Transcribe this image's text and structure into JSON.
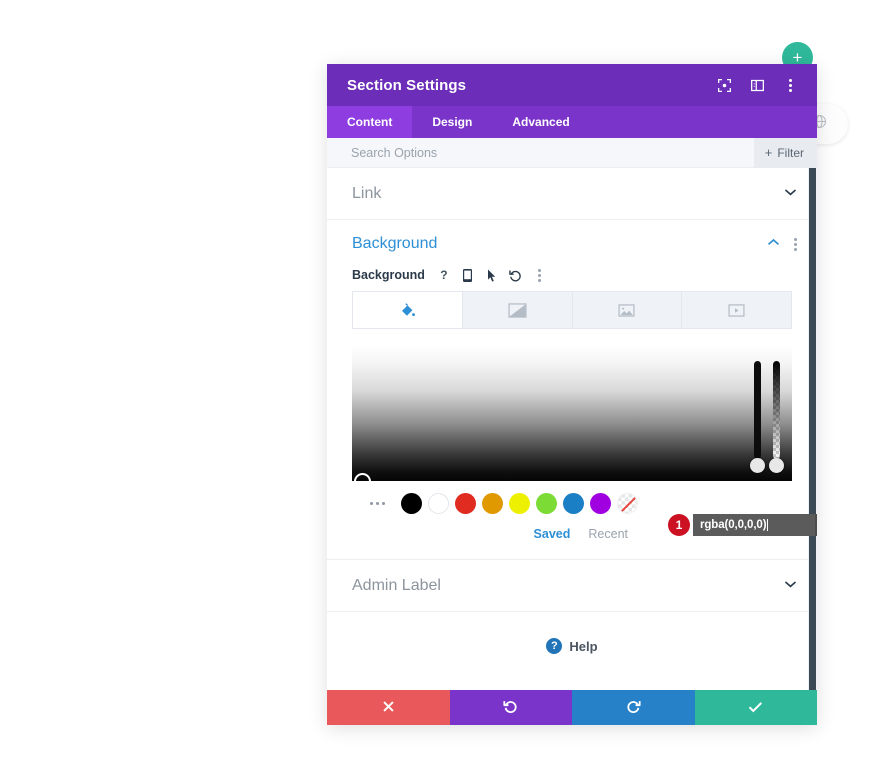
{
  "canvas": {
    "background": "#ffffff",
    "add_section_button": {
      "label": "+",
      "color": "#2fb99a",
      "icon": "plus-icon"
    },
    "globe_button": {
      "icon": "globe-icon"
    }
  },
  "panel": {
    "title": "Section Settings",
    "accent": "#6c2eb9",
    "header_icons": [
      {
        "name": "fullscreen-icon"
      },
      {
        "name": "split-view-icon"
      },
      {
        "name": "more-options-icon"
      }
    ],
    "tabs": [
      {
        "label": "Content",
        "active": true
      },
      {
        "label": "Design",
        "active": false
      },
      {
        "label": "Advanced",
        "active": false
      }
    ],
    "search": {
      "placeholder": "Search Options",
      "value": "",
      "filter_label": "Filter",
      "filter_plus": "+"
    },
    "sections": [
      {
        "label": "Link",
        "state": "collapsed"
      },
      {
        "label": "Background",
        "state": "expanded"
      },
      {
        "label": "Admin Label",
        "state": "collapsed"
      }
    ],
    "background_section": {
      "title": "Background",
      "field_label": "Background",
      "field_icons": [
        {
          "name": "help-icon",
          "glyph": "?"
        },
        {
          "name": "responsive-mobile-icon"
        },
        {
          "name": "hover-cursor-icon"
        },
        {
          "name": "reset-icon"
        },
        {
          "name": "option-menu-icon"
        }
      ],
      "type_tabs": [
        {
          "name": "background-color-tab",
          "icon": "paint-bucket-icon",
          "active": true
        },
        {
          "name": "background-gradient-tab",
          "icon": "gradient-icon",
          "active": false
        },
        {
          "name": "background-image-tab",
          "icon": "image-icon",
          "active": false
        },
        {
          "name": "background-video-tab",
          "icon": "video-icon",
          "active": false
        }
      ],
      "color_picker": {
        "input_value": "rgba(0,0,0,0)",
        "confirm_icon": "checkmark-icon",
        "step_badge": "1",
        "badge_color": "#cc1122",
        "hue_slider": {
          "name": "hue-slider",
          "value": 0
        },
        "alpha_slider": {
          "name": "alpha-slider",
          "value": 0
        }
      },
      "swatches": [
        {
          "name": "swatch-more",
          "color": ""
        },
        {
          "name": "swatch-black",
          "color": "#000000"
        },
        {
          "name": "swatch-white",
          "color": "#ffffff"
        },
        {
          "name": "swatch-red",
          "color": "#e02b20"
        },
        {
          "name": "swatch-orange",
          "color": "#e09900"
        },
        {
          "name": "swatch-yellow",
          "color": "#edf000"
        },
        {
          "name": "swatch-green",
          "color": "#7cdb34"
        },
        {
          "name": "swatch-blue",
          "color": "#1a7fc4"
        },
        {
          "name": "swatch-purple",
          "color": "#a000e0"
        },
        {
          "name": "swatch-transparent",
          "color": "none"
        }
      ],
      "palette_tabs": [
        {
          "label": "Saved",
          "active": true
        },
        {
          "label": "Recent",
          "active": false
        }
      ]
    },
    "help": {
      "label": "Help",
      "icon": "question-circle-icon"
    },
    "footer_buttons": [
      {
        "name": "cancel-button",
        "icon": "close-icon",
        "glyph": "✖",
        "color": "#e9595b"
      },
      {
        "name": "undo-button",
        "icon": "undo-icon",
        "glyph": "↺",
        "color": "#7b34c9"
      },
      {
        "name": "redo-button",
        "icon": "redo-icon",
        "glyph": "↻",
        "color": "#2681c8"
      },
      {
        "name": "save-button",
        "icon": "checkmark-icon",
        "glyph": "✔",
        "color": "#2fb99a"
      }
    ]
  }
}
